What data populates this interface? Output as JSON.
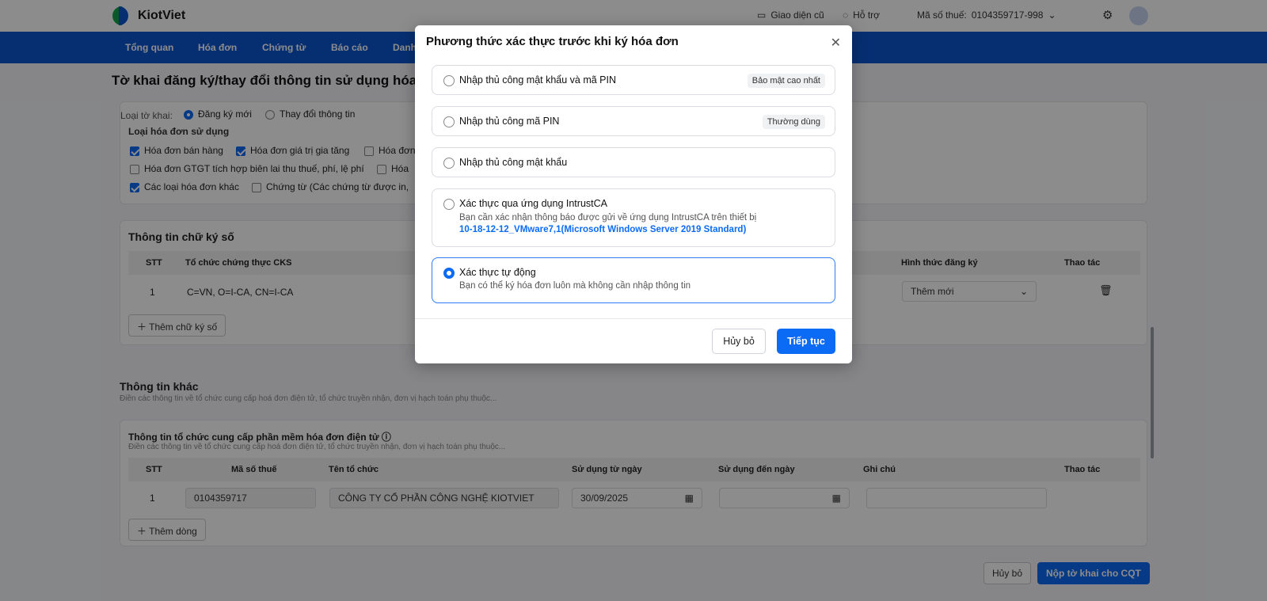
{
  "app": {
    "name": "KiotViet"
  },
  "topbar": {
    "old_ui": "Giao diện cũ",
    "support": "Hỗ trợ",
    "tax_label": "Mã số thuế:",
    "tax_value": "0104359717-998"
  },
  "nav": [
    "Tổng quan",
    "Hóa đơn",
    "Chứng từ",
    "Báo cáo",
    "Danh"
  ],
  "page_title": "Tờ khai đăng ký/thay đổi thông tin sử dụng hóa",
  "form": {
    "type_label": "Loại tờ khai:",
    "type_options": [
      "Đăng ký mới",
      "Thay đổi thông tin"
    ],
    "invoice_types_title": "Loại hóa đơn sử dụng",
    "invoice_types": [
      "Hóa đơn bán hàng",
      "Hóa đơn giá trị gia tăng",
      "Hóa đơn",
      "Hóa đơn GTGT tích hợp biên lai thu thuế, phí, lệ phí",
      "Hóa",
      "Các loại hóa đơn khác",
      "Chứng từ (Các chứng từ được in,"
    ]
  },
  "signature": {
    "title": "Thông tin chữ ký số",
    "headers": [
      "STT",
      "Tổ chức chứng thực CKS",
      "Hình thức đăng ký",
      "Thao tác"
    ],
    "row": {
      "stt": "1",
      "org": "C=VN, O=I-CA, CN=I-CA",
      "form": "Thêm mới"
    },
    "add_button": "Thêm chữ ký số"
  },
  "other": {
    "title": "Thông tin khác",
    "desc": "Điền các thông tin về tổ chức cung cấp hoá đơn điện tử, tổ chức truyền nhận, đơn vị hạch toán phụ thuộc...",
    "provider_title": "Thông tin tổ chức cung cấp phần mềm hóa đơn điện tử",
    "provider_desc": "Điền các thông tin về tổ chức cung cấp hoá đơn điện tử, tổ chức truyền nhận, đơn vị hạch toán phụ thuộc...",
    "headers": [
      "STT",
      "Mã số thuế",
      "Tên tổ chức",
      "Sử dụng từ ngày",
      "Sử dụng đến ngày",
      "Ghi chú",
      "Thao tác"
    ],
    "row": {
      "stt": "1",
      "tax": "0104359717",
      "name": "CÔNG TY CỔ PHẦN CÔNG NGHỆ KIOTVIET",
      "from": "30/09/2025"
    },
    "add_row": "Thêm dòng"
  },
  "footer": {
    "cancel": "Hủy bỏ",
    "submit": "Nộp tờ khai cho CQT"
  },
  "modal": {
    "title": "Phương thức xác thực trước khi ký hóa đơn",
    "options": [
      {
        "label": "Nhập thủ công mật khẩu và mã PIN",
        "badge": "Bảo mật cao nhất"
      },
      {
        "label": "Nhập thủ công mã PIN",
        "badge": "Thường dùng"
      },
      {
        "label": "Nhập thủ công mật khẩu"
      },
      {
        "label": "Xác thực qua ứng dụng IntrustCA",
        "sub": "Bạn cần xác nhận thông báo được gửi về ứng dụng IntrustCA trên thiết bị",
        "device": "10-18-12-12_VMware7,1(Microsoft Windows Server 2019 Standard)"
      },
      {
        "label": "Xác thực tự động",
        "sub": "Bạn có thể ký hóa đơn luôn mà không cần nhập thông tin"
      }
    ],
    "selected_index": 4,
    "cancel": "Hủy bỏ",
    "continue": "Tiếp tục"
  },
  "colors": {
    "primary": "#0b6bf5",
    "nav": "#0b57d0",
    "overlay": "rgba(0,0,0,0.45)"
  }
}
